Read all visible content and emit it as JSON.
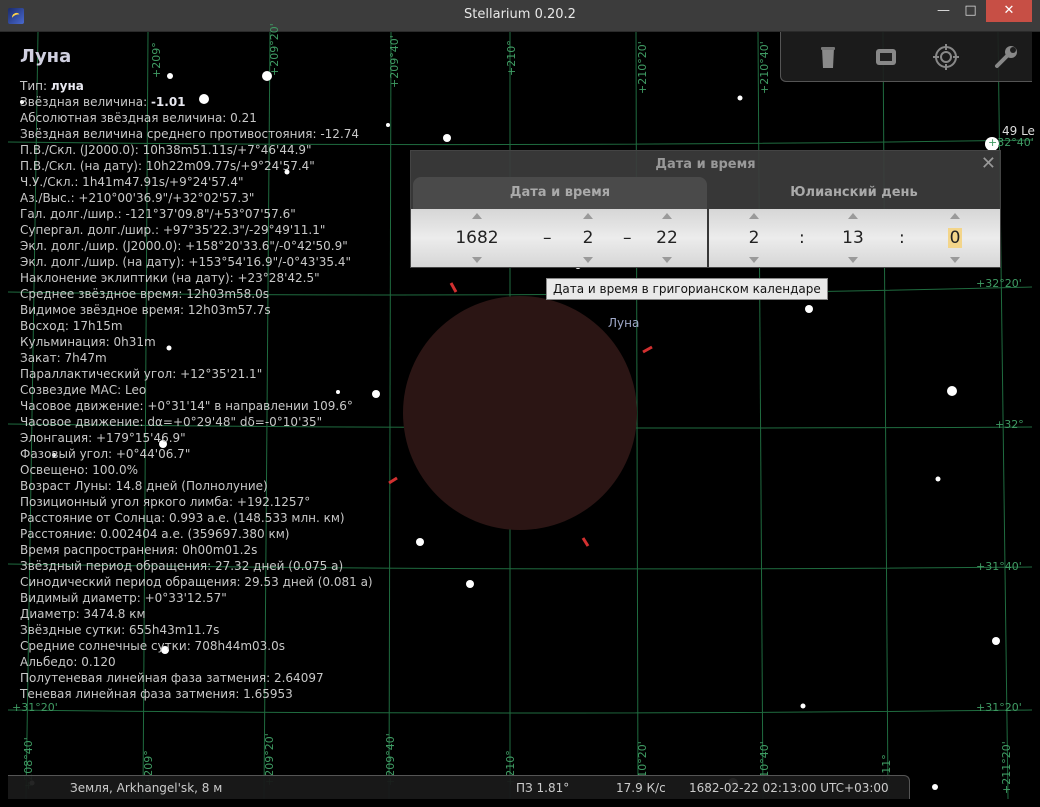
{
  "window": {
    "title": "Stellarium 0.20.2",
    "minimize": "—",
    "maximize": "□",
    "close": "✕"
  },
  "object": {
    "name": "Луна",
    "lines": [
      {
        "label": "Тип: ",
        "value": "луна",
        "bold": true
      },
      {
        "label": "Звёздная величина: ",
        "value": "-1.01",
        "bold": true
      },
      {
        "label": "Абсолютная звёздная величина: 0.21"
      },
      {
        "label": "Звёздная величина среднего противостояния: -12.74"
      },
      {
        "label": "П.В./Скл. (J2000.0): 10h38m51.11s/+7°46'44.9\""
      },
      {
        "label": "П.В./Скл. (на дату): 10h22m09.77s/+9°24'57.4\""
      },
      {
        "label": "Ч.У./Скл.: 1h41m47.91s/+9°24'57.4\""
      },
      {
        "label": "Аз./Выс.: +210°00'36.9\"/+32°02'57.3\""
      },
      {
        "label": "Гал. долг./шир.: -121°37'09.8\"/+53°07'57.6\""
      },
      {
        "label": "Супергал. долг./шир.: +97°35'22.3\"/-29°49'11.1\""
      },
      {
        "label": "Экл. долг./шир. (J2000.0): +158°20'33.6\"/-0°42'50.9\""
      },
      {
        "label": "Экл. долг./шир. (на дату): +153°54'16.9\"/-0°43'35.4\""
      },
      {
        "label": "Наклонение эклиптики (на дату): +23°28'42.5\""
      },
      {
        "label": "Среднее звёздное время: 12h03m58.0s"
      },
      {
        "label": "Видимое звёздное время: 12h03m57.7s"
      },
      {
        "label": "Восход: 17h15m"
      },
      {
        "label": "Кульминация: 0h31m"
      },
      {
        "label": "Закат: 7h47m"
      },
      {
        "label": "Параллактический угол: +12°35'21.1\""
      },
      {
        "label": "Созвездие МАС: Leo"
      },
      {
        "label": "Часовое движение: +0°31'14\" в направлении 109.6°"
      },
      {
        "label": "Часовое движение: dα=+0°29'48\" dδ=-0°10'35\""
      },
      {
        "label": "Элонгация: +179°15'46.9\""
      },
      {
        "label": "Фазовый угол: +0°44'06.7\""
      },
      {
        "label": "Освещено: 100.0%"
      },
      {
        "label": "Возраст Луны: 14.8 дней (Полнолуние)"
      },
      {
        "label": "Позиционный угол яркого лимба: +192.1257°"
      },
      {
        "label": "Расстояние от Солнца: 0.993 а.е. (148.533 млн. км)"
      },
      {
        "label": "Расстояние: 0.002404 а.е. (359697.380 км)"
      },
      {
        "label": "Время распространения: 0h00m01.2s"
      },
      {
        "label": "Звёздный период обращения: 27.32 дней (0.075 а)"
      },
      {
        "label": "Синодический период обращения: 29.53 дней (0.081 а)"
      },
      {
        "label": "Видимый диаметр: +0°33'12.57\""
      },
      {
        "label": "Диаметр: 3474.8 км"
      },
      {
        "label": "Звёздные сутки: 655h43m11.7s"
      },
      {
        "label": "Средние солнечные сутки: 708h44m03.0s"
      },
      {
        "label": "Альбедо: 0.120"
      },
      {
        "label": "Полутеневая линейная фаза затмения: 2.64097"
      },
      {
        "label": "Теневая линейная фаза затмения: 1.65953"
      }
    ]
  },
  "sky_labels": {
    "moon": "Луна",
    "side": "49 Le",
    "grid": {
      "top": [
        "+209°",
        "+209°20'",
        "+209°40'",
        "+210°",
        "+210°20'",
        "+210°40'",
        "+210°"
      ],
      "bottom": [
        "+208°40'",
        "+209°",
        "+209°20'",
        "+209°40'",
        "+210°",
        "+210°20'",
        "+210°40'",
        "+211°",
        "+211°20'"
      ],
      "right": [
        "+32°40'",
        "+32°20'",
        "+32°",
        "+31°40'",
        "+31°20'"
      ],
      "left": [
        "+31°20'"
      ]
    }
  },
  "toolbar": {
    "buttons": [
      "bucket-icon",
      "window-icon",
      "target-icon",
      "wrench-icon"
    ]
  },
  "datetime_dialog": {
    "title": "Дата и время",
    "close": "✕",
    "tab_datetime": "Дата и время",
    "tab_julian": "Юлианский день",
    "year": "1682",
    "month": "2",
    "day": "22",
    "hour": "2",
    "minute": "13",
    "second": "0",
    "date_sep": "–",
    "time_sep": ":"
  },
  "tooltip": "Дата и время в григорианском календаре",
  "statusbar": {
    "location": "Земля, Arkhangel'sk, 8 м",
    "fov": "ПЗ 1.81°",
    "fps": "17.9 К/с",
    "datetime": "1682-02-22 02:13:00 UTC+03:00"
  },
  "colors": {
    "grid": "#1f6b3f",
    "grid_label": "#3f9b63",
    "moon": "#2b1514",
    "marker": "#d23030"
  }
}
